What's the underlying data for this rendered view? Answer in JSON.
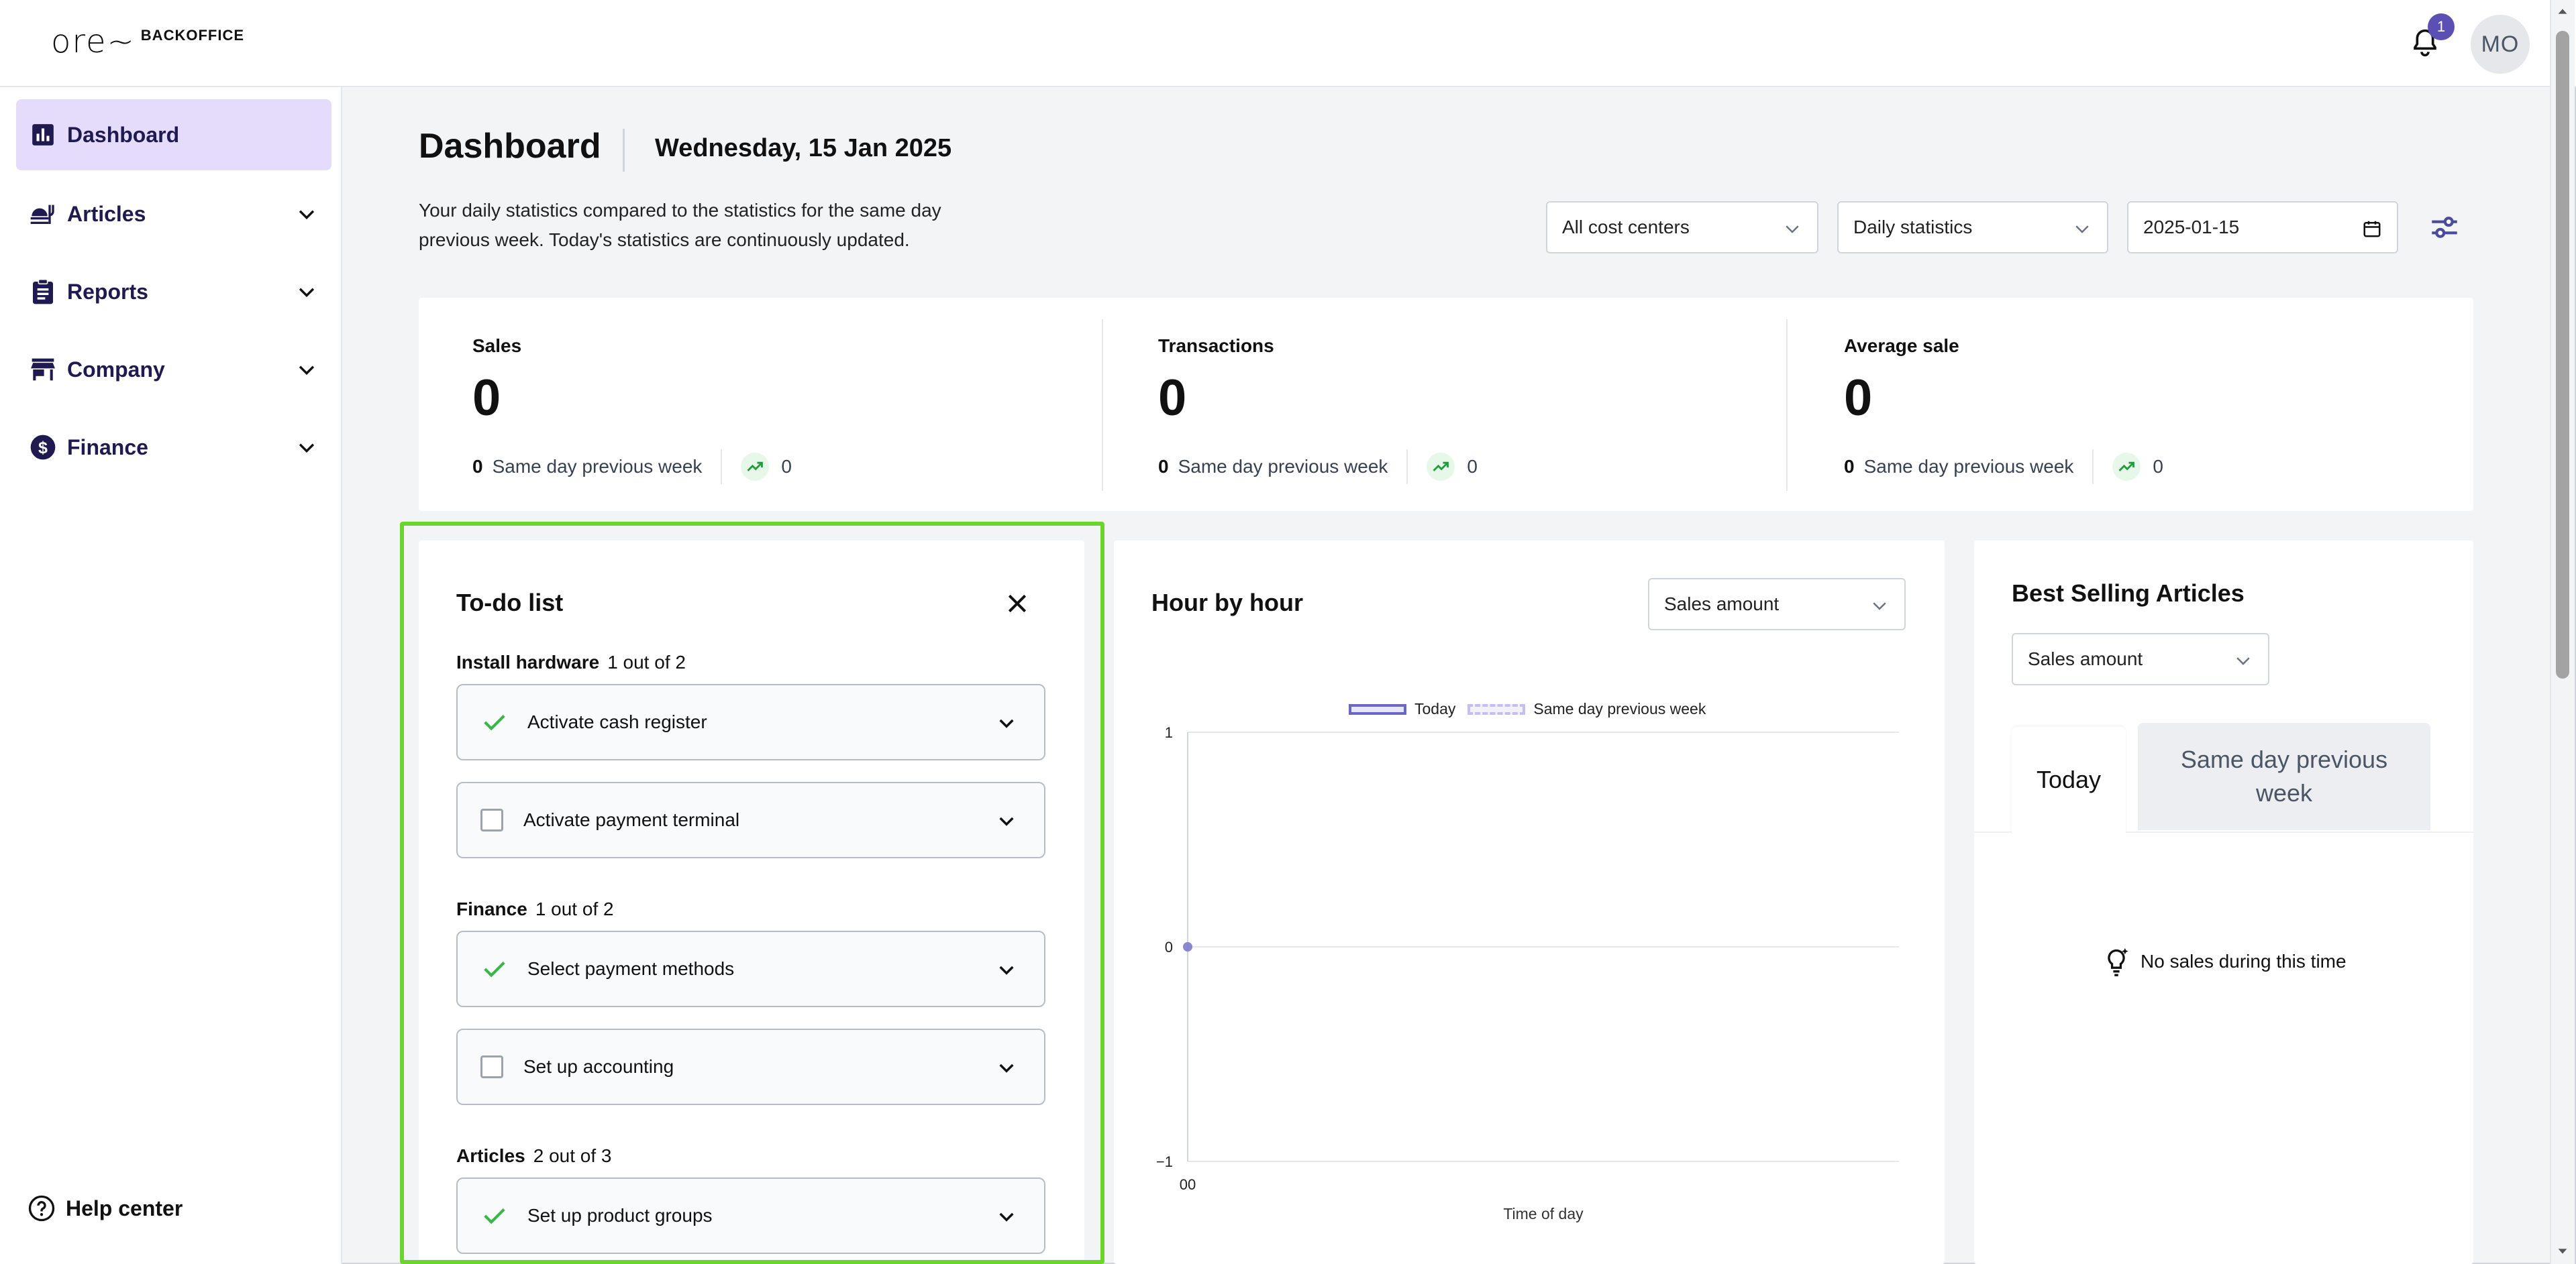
{
  "brand": {
    "logo_mark": "ore~",
    "logo_text": "BACKOFFICE"
  },
  "header": {
    "notification_count": "1",
    "avatar_initials": "MO"
  },
  "sidebar": {
    "items": [
      {
        "label": "Dashboard",
        "icon": "bar-chart-icon",
        "active": true
      },
      {
        "label": "Articles",
        "icon": "food-icon",
        "expandable": true
      },
      {
        "label": "Reports",
        "icon": "clipboard-icon",
        "expandable": true
      },
      {
        "label": "Company",
        "icon": "store-icon",
        "expandable": true
      },
      {
        "label": "Finance",
        "icon": "dollar-circle-icon",
        "expandable": true
      }
    ],
    "help_label": "Help center"
  },
  "page": {
    "title": "Dashboard",
    "date": "Wednesday, 15 Jan 2025",
    "description": "Your daily statistics compared to the statistics for the same day previous week. Today's statistics are continuously updated."
  },
  "filters": {
    "cost_center": "All cost centers",
    "statistics": "Daily statistics",
    "date": "2025-01-15"
  },
  "stats": [
    {
      "label": "Sales",
      "value": "0",
      "prev_value": "0",
      "prev_label": "Same day previous week",
      "change": "0"
    },
    {
      "label": "Transactions",
      "value": "0",
      "prev_value": "0",
      "prev_label": "Same day previous week",
      "change": "0"
    },
    {
      "label": "Average sale",
      "value": "0",
      "prev_value": "0",
      "prev_label": "Same day previous week",
      "change": "0"
    }
  ],
  "todo": {
    "title": "To-do list",
    "groups": [
      {
        "name": "Install hardware",
        "progress": "1 out of 2",
        "tasks": [
          {
            "label": "Activate cash register",
            "done": true
          },
          {
            "label": "Activate payment terminal",
            "done": false
          }
        ]
      },
      {
        "name": "Finance",
        "progress": "1 out of 2",
        "tasks": [
          {
            "label": "Select payment methods",
            "done": true
          },
          {
            "label": "Set up accounting",
            "done": false
          }
        ]
      },
      {
        "name": "Articles",
        "progress": "2 out of 3",
        "tasks": [
          {
            "label": "Set up product groups",
            "done": true
          }
        ]
      }
    ]
  },
  "hour_by_hour": {
    "title": "Hour by hour",
    "metric": "Sales amount"
  },
  "best_selling": {
    "title": "Best Selling Articles",
    "metric": "Sales amount",
    "tabs": [
      "Today",
      "Same day previous week"
    ],
    "empty_message": "No sales during this time"
  },
  "chart_data": {
    "type": "line",
    "x": [
      "00"
    ],
    "series": [
      {
        "name": "Today",
        "values": [
          0
        ],
        "color": "#6c66c4"
      },
      {
        "name": "Same day previous week",
        "values": [
          0
        ],
        "color": "#c3bfee"
      }
    ],
    "xlabel": "Time of day",
    "ylabel": "",
    "ylim": [
      -1,
      1
    ],
    "yticks": [
      "1",
      "0",
      "−1"
    ],
    "legend": "top-center",
    "grid": true
  },
  "colors": {
    "accent": "#5b4fb3",
    "active_nav": "#e4dcfa",
    "highlight": "#6bd52b",
    "success": "#3bb54a"
  }
}
